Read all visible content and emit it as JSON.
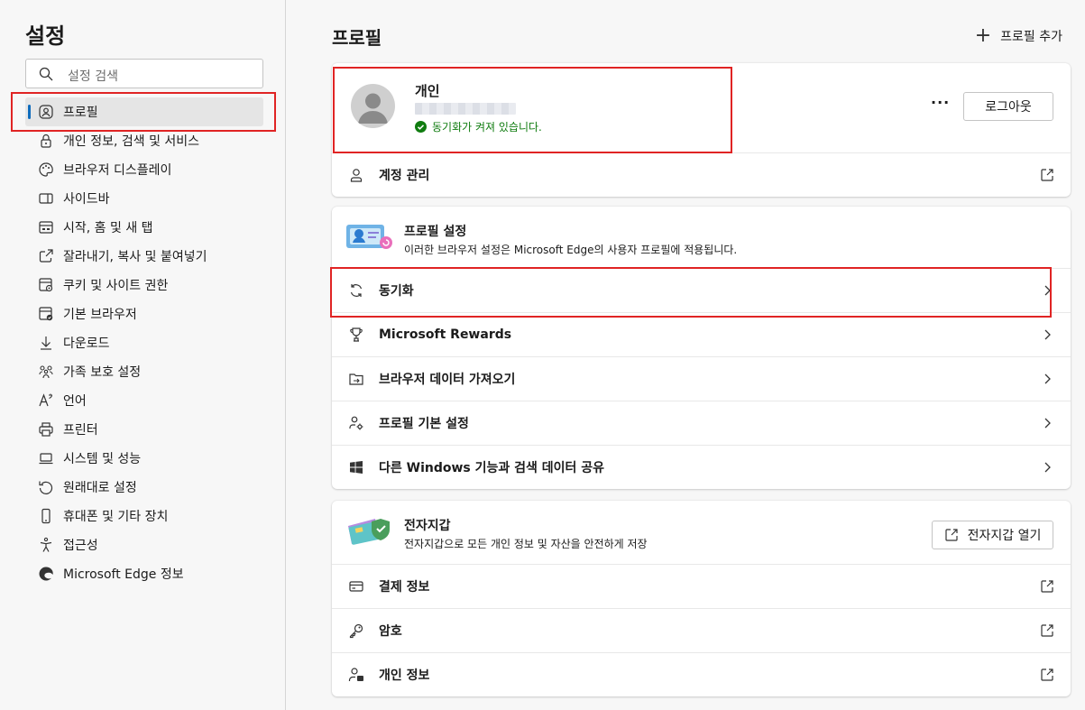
{
  "sidebar": {
    "title": "설정",
    "search_placeholder": "설정 검색",
    "items": [
      {
        "label": "프로필",
        "icon": "profile-icon",
        "active": true
      },
      {
        "label": "개인 정보, 검색 및 서비스",
        "icon": "lock-icon"
      },
      {
        "label": "브라우저 디스플레이",
        "icon": "palette-icon"
      },
      {
        "label": "사이드바",
        "icon": "sidebar-icon"
      },
      {
        "label": "시작, 홈 및 새 탭",
        "icon": "home-tab-icon"
      },
      {
        "label": "잘라내기, 복사 및 붙여넣기",
        "icon": "share-icon"
      },
      {
        "label": "쿠키 및 사이트 권한",
        "icon": "cookie-icon"
      },
      {
        "label": "기본 브라우저",
        "icon": "browser-icon"
      },
      {
        "label": "다운로드",
        "icon": "download-icon"
      },
      {
        "label": "가족 보호 설정",
        "icon": "family-icon"
      },
      {
        "label": "언어",
        "icon": "language-icon"
      },
      {
        "label": "프린터",
        "icon": "printer-icon"
      },
      {
        "label": "시스템 및 성능",
        "icon": "laptop-icon"
      },
      {
        "label": "원래대로 설정",
        "icon": "reset-icon"
      },
      {
        "label": "휴대폰 및 기타 장치",
        "icon": "phone-icon"
      },
      {
        "label": "접근성",
        "icon": "accessibility-icon"
      },
      {
        "label": "Microsoft Edge 정보",
        "icon": "edge-icon"
      }
    ]
  },
  "main": {
    "title": "프로필",
    "add_profile": "프로필 추가",
    "profile": {
      "name": "개인",
      "sync_status": "동기화가 켜져 있습니다.",
      "more": "···",
      "logout": "로그아웃",
      "manage_account": "계정 관리"
    },
    "profile_settings": {
      "title": "프로필 설정",
      "desc": "이러한 브라우저 설정은 Microsoft Edge의 사용자 프로필에 적용됩니다.",
      "rows": [
        {
          "label": "동기화",
          "icon": "sync-icon"
        },
        {
          "label": "Microsoft Rewards",
          "icon": "trophy-icon"
        },
        {
          "label": "브라우저 데이터 가져오기",
          "icon": "import-icon"
        },
        {
          "label": "프로필 기본 설정",
          "icon": "profile-preferences-icon"
        },
        {
          "label": "다른 Windows 기능과 검색 데이터 공유",
          "icon": "windows-icon"
        }
      ]
    },
    "wallet": {
      "title": "전자지갑",
      "desc": "전자지갑으로 모든 개인 정보 및 자산을 안전하게 저장",
      "open_button": "전자지갑 열기",
      "rows": [
        {
          "label": "결제 정보",
          "icon": "credit-card-icon"
        },
        {
          "label": "암호",
          "icon": "key-icon"
        },
        {
          "label": "개인 정보",
          "icon": "personal-info-icon"
        }
      ]
    }
  }
}
